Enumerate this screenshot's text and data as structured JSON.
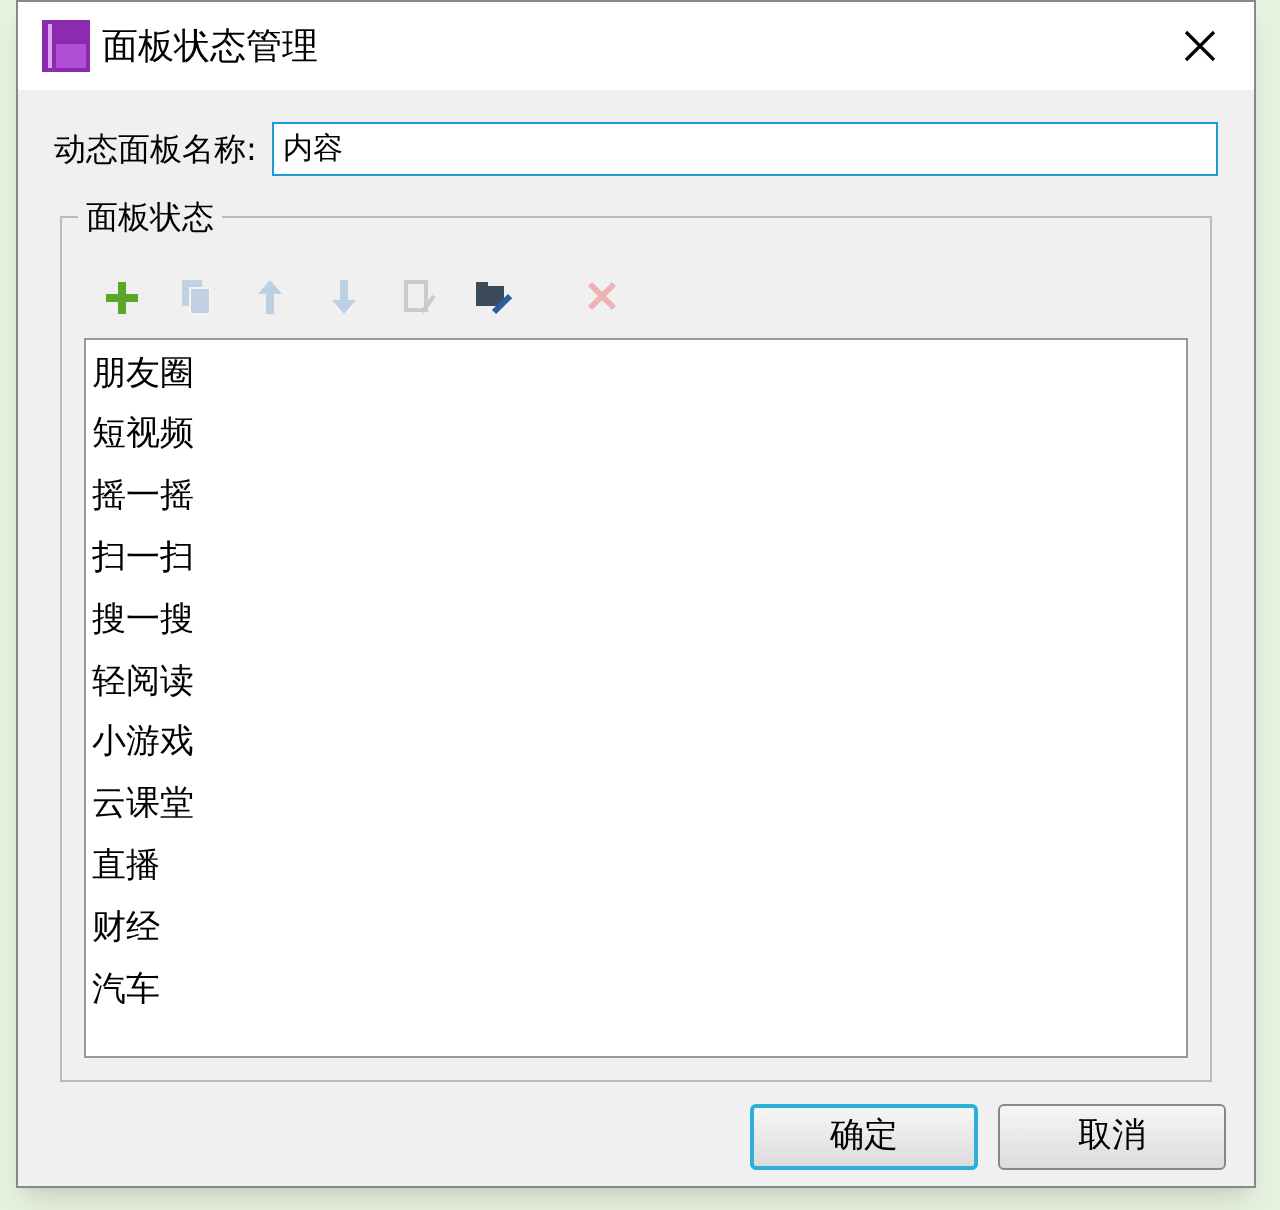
{
  "window": {
    "title": "面板状态管理"
  },
  "name_field": {
    "label": "动态面板名称:",
    "value": "内容"
  },
  "group": {
    "title": "面板状态"
  },
  "toolbar": [
    {
      "kind": "add",
      "disabled": false
    },
    {
      "kind": "copy",
      "disabled": true
    },
    {
      "kind": "up",
      "disabled": true
    },
    {
      "kind": "down",
      "disabled": true
    },
    {
      "kind": "duplicate",
      "disabled": true
    },
    {
      "kind": "edit",
      "disabled": false
    },
    {
      "kind": "delete",
      "disabled": true
    }
  ],
  "states": [
    {
      "label": "朋友圈",
      "selected": false
    },
    {
      "label": "短视频",
      "selected": false
    },
    {
      "label": "摇一摇",
      "selected": false
    },
    {
      "label": "扫一扫",
      "selected": false
    },
    {
      "label": "搜一搜",
      "selected": false
    },
    {
      "label": "轻阅读",
      "selected": false
    },
    {
      "label": "小游戏",
      "selected": false
    },
    {
      "label": "云课堂",
      "selected": false
    },
    {
      "label": "直播",
      "selected": false
    },
    {
      "label": "财经",
      "selected": false
    },
    {
      "label": "汽车",
      "selected": false
    }
  ],
  "buttons": [
    {
      "label": "确定",
      "default": true
    },
    {
      "label": "取消",
      "default": false
    }
  ]
}
